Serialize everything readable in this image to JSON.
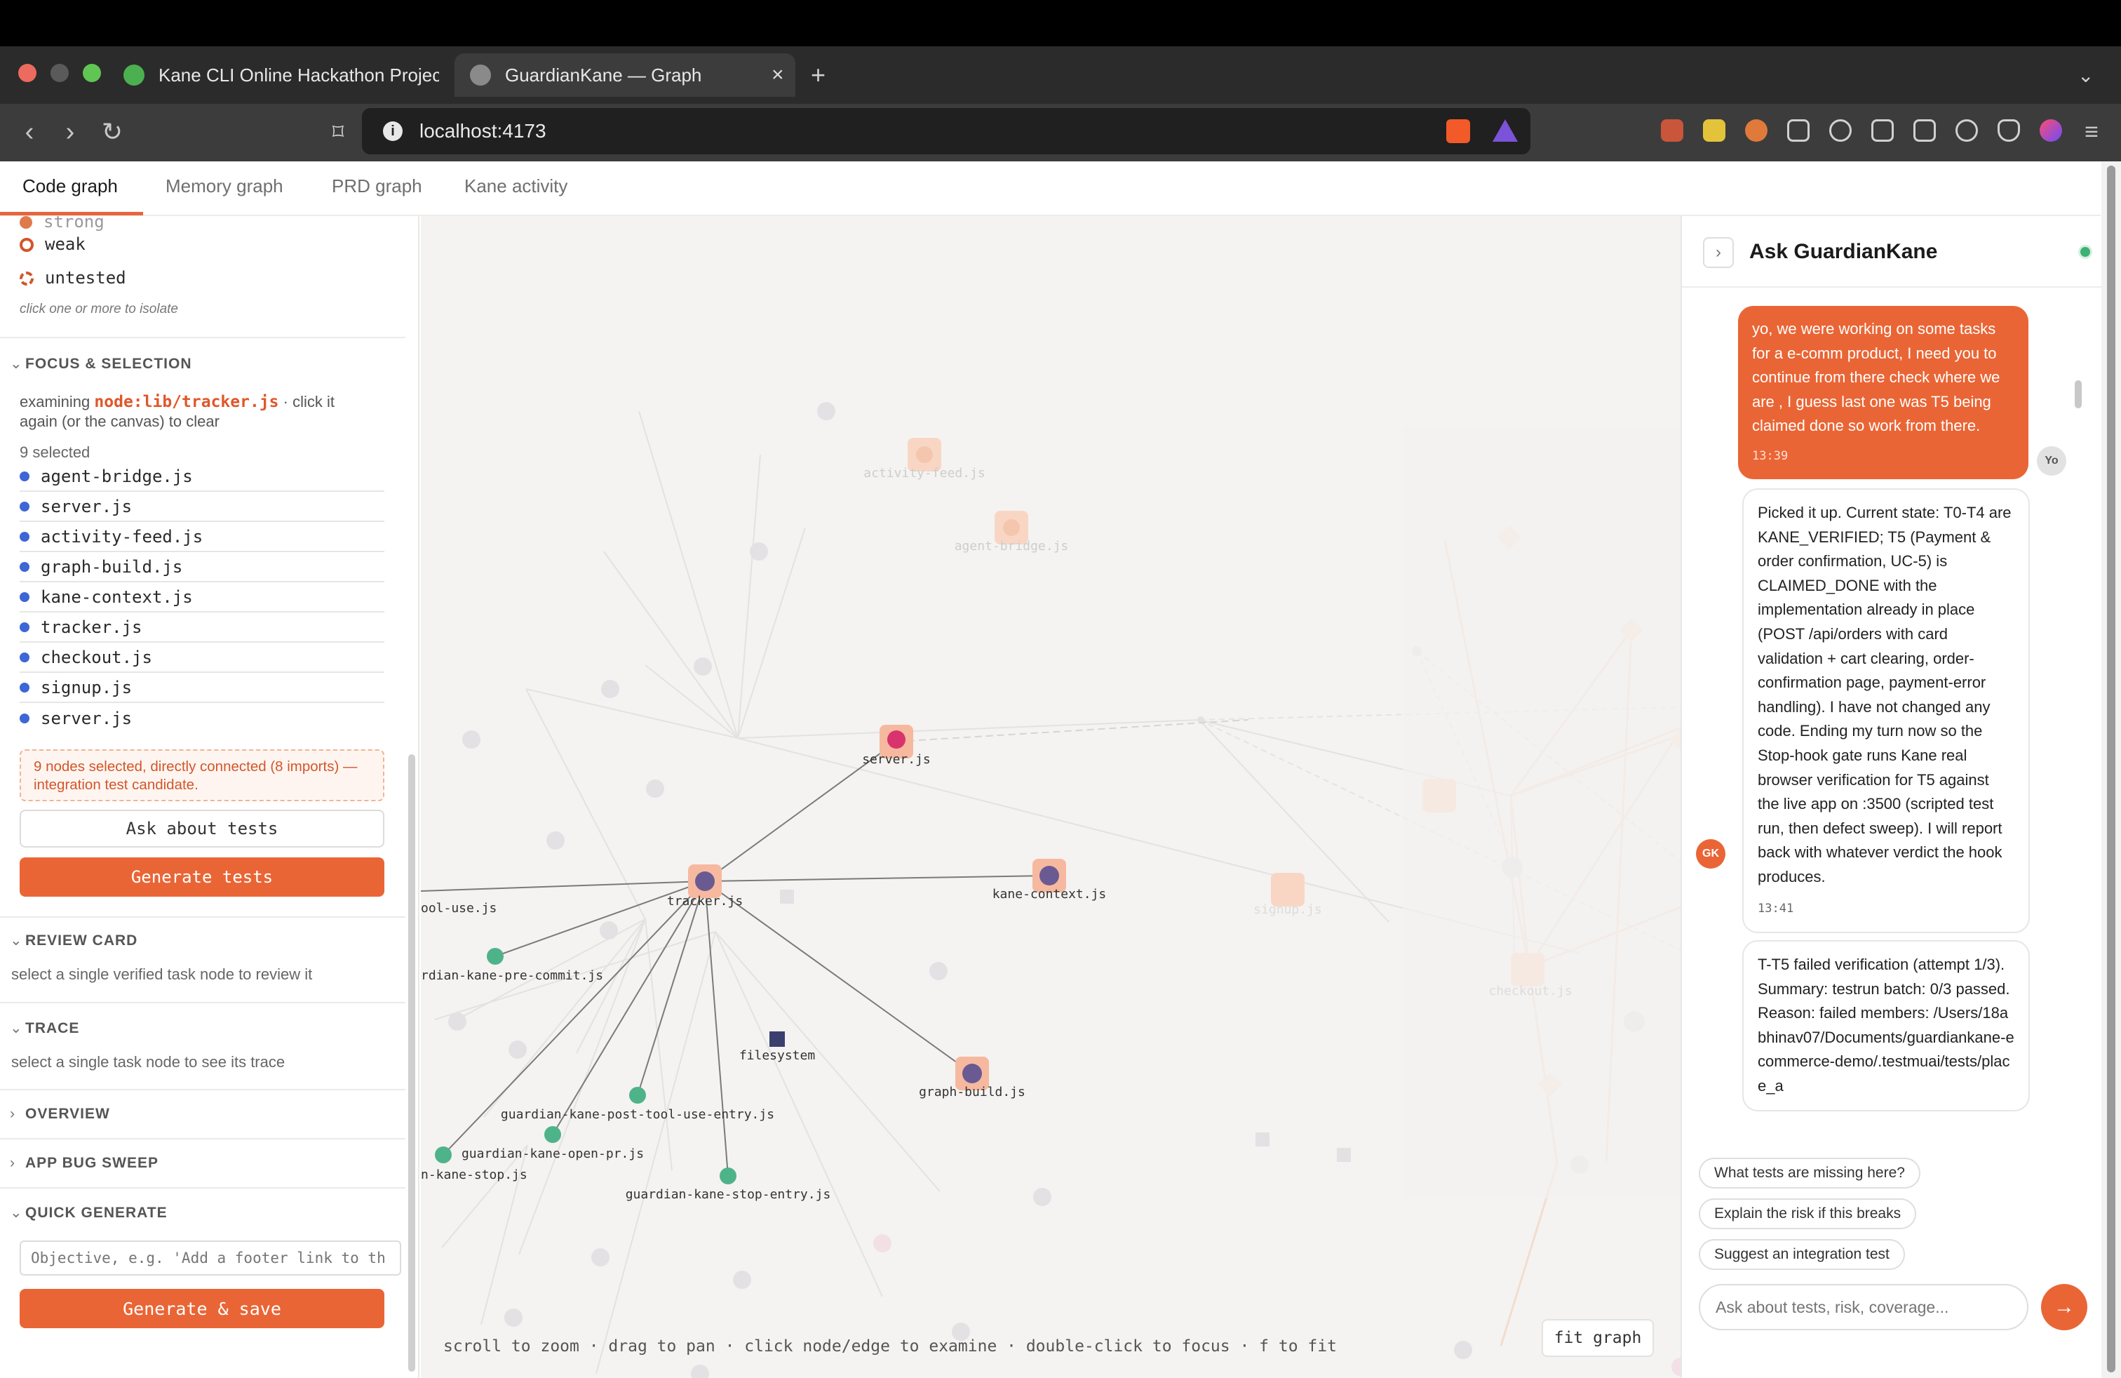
{
  "browser": {
    "tabs": [
      {
        "title": "Kane CLI Online Hackathon Project"
      },
      {
        "title": "GuardianKane — Graph"
      }
    ],
    "new_tab": "+",
    "url": "localhost:4173",
    "colors": {
      "close": "#ec6a5e",
      "minimize": "#f4bf4f",
      "maximize": "#61c554"
    }
  },
  "app_tabs": [
    "Code graph",
    "Memory graph",
    "PRD graph",
    "Kane activity"
  ],
  "left_panel": {
    "legend": [
      {
        "label": "strong"
      },
      {
        "label": "weak"
      },
      {
        "label": "untested"
      }
    ],
    "legend_hint": "click one or more to isolate",
    "focus_section": "FOCUS & SELECTION",
    "examining_prefix": "examining",
    "examining_node": "node:lib/tracker.js",
    "examining_suffix": "· click it",
    "examining_line2": "again (or the canvas) to clear",
    "selected_count": "9 selected",
    "selected_items": [
      "agent-bridge.js",
      "server.js",
      "activity-feed.js",
      "graph-build.js",
      "kane-context.js",
      "tracker.js",
      "checkout.js",
      "signup.js",
      "server.js"
    ],
    "notice": "9 nodes selected, directly connected (8 imports) — integration test candidate.",
    "ask_button": "Ask about tests",
    "generate_button": "Generate tests",
    "review_section": "REVIEW CARD",
    "review_hint": "select a single verified task node to review it",
    "trace_section": "TRACE",
    "trace_hint": "select a single task node to see its trace",
    "overview_section": "OVERVIEW",
    "bugsweep_section": "APP BUG SWEEP",
    "quickgen_section": "QUICK GENERATE",
    "objective_placeholder": "Objective, e.g. 'Add a footer link to th",
    "generate_save_button": "Generate & save"
  },
  "graph": {
    "labels": {
      "server": "server.js",
      "tracker": "tracker.js",
      "kane_context": "kane-context.js",
      "graph_build": "graph-build.js",
      "filesystem": "filesystem",
      "tool_use": "ool-use.js",
      "pre_commit": "rdian-kane-pre-commit.js",
      "post_tool": "guardian-kane-post-tool-use-entry.js",
      "open_pr": "guardian-kane-open-pr.js",
      "kane_stop": "n-kane-stop.js",
      "stop_entry": "guardian-kane-stop-entry.js",
      "faded_activity": "activity-feed.js",
      "faded_agent": "agent-bridge.js",
      "faded_signup": "signup.js",
      "faded_checkout": "checkout.js"
    },
    "hint": "scroll to zoom · drag to pan · click node/edge to examine · double-click to focus · f to fit",
    "fit_button": "fit graph"
  },
  "chat": {
    "title": "Ask GuardianKane",
    "messages": [
      {
        "role": "user",
        "avatar": "Yo",
        "text": "yo, we were working on some tasks for a e-comm product, I need you to continue from there check where we are , I guess last one was T5 being claimed done so work from there.",
        "time": "13:39"
      },
      {
        "role": "assistant",
        "avatar": "GK",
        "text": "Picked it up. Current state: T0-T4 are KANE_VERIFIED; T5 (Payment & order confirmation, UC-5) is CLAIMED_DONE with the implementation already in place (POST /api/orders with card validation + cart clearing, order-confirmation page, payment-error handling). I have not changed any code. Ending my turn now so the Stop-hook gate runs Kane real browser verification for T5 against the live app on :3500 (scripted test run, then defect sweep). I will report back with whatever verdict the hook produces.",
        "time": "13:41"
      },
      {
        "role": "assistant",
        "avatar": "GK",
        "text": "T-T5 failed verification (attempt 1/3). Summary: testrun batch: 0/3 passed. Reason: failed members: /Users/18abhinav07/Documents/guardiankane-ecommerce-demo/.testmuai/tests/place_a",
        "time": ""
      }
    ],
    "suggestions": [
      "What tests are missing here?",
      "Explain the risk if this breaks",
      "Suggest an integration test"
    ],
    "input_placeholder": "Ask about tests, risk, coverage..."
  },
  "colors": {
    "accent": "#ea6535",
    "node_blue": "#3d66d6",
    "node_green": "#4fb38a",
    "server_pink": "#d9336d"
  }
}
